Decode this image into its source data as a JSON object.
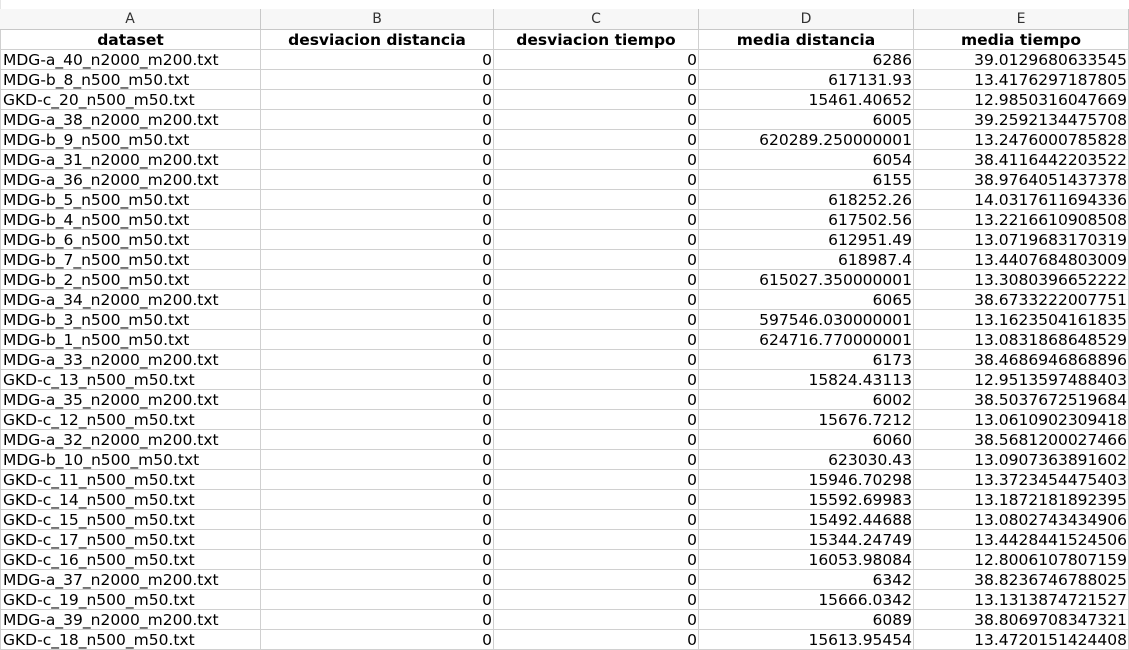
{
  "columns": [
    "A",
    "B",
    "C",
    "D",
    "E"
  ],
  "headers": [
    "dataset",
    "desviacion distancia",
    "desviacion tiempo",
    "media distancia",
    "media tiempo"
  ],
  "rows": [
    [
      "MDG-a_40_n2000_m200.txt",
      "0",
      "0",
      "6286",
      "39.0129680633545"
    ],
    [
      "MDG-b_8_n500_m50.txt",
      "0",
      "0",
      "617131.93",
      "13.4176297187805"
    ],
    [
      "GKD-c_20_n500_m50.txt",
      "0",
      "0",
      "15461.40652",
      "12.9850316047669"
    ],
    [
      "MDG-a_38_n2000_m200.txt",
      "0",
      "0",
      "6005",
      "39.2592134475708"
    ],
    [
      "MDG-b_9_n500_m50.txt",
      "0",
      "0",
      "620289.250000001",
      "13.2476000785828"
    ],
    [
      "MDG-a_31_n2000_m200.txt",
      "0",
      "0",
      "6054",
      "38.4116442203522"
    ],
    [
      "MDG-a_36_n2000_m200.txt",
      "0",
      "0",
      "6155",
      "38.9764051437378"
    ],
    [
      "MDG-b_5_n500_m50.txt",
      "0",
      "0",
      "618252.26",
      "14.0317611694336"
    ],
    [
      "MDG-b_4_n500_m50.txt",
      "0",
      "0",
      "617502.56",
      "13.2216610908508"
    ],
    [
      "MDG-b_6_n500_m50.txt",
      "0",
      "0",
      "612951.49",
      "13.0719683170319"
    ],
    [
      "MDG-b_7_n500_m50.txt",
      "0",
      "0",
      "618987.4",
      "13.4407684803009"
    ],
    [
      "MDG-b_2_n500_m50.txt",
      "0",
      "0",
      "615027.350000001",
      "13.3080396652222"
    ],
    [
      "MDG-a_34_n2000_m200.txt",
      "0",
      "0",
      "6065",
      "38.6733222007751"
    ],
    [
      "MDG-b_3_n500_m50.txt",
      "0",
      "0",
      "597546.030000001",
      "13.1623504161835"
    ],
    [
      "MDG-b_1_n500_m50.txt",
      "0",
      "0",
      "624716.770000001",
      "13.0831868648529"
    ],
    [
      "MDG-a_33_n2000_m200.txt",
      "0",
      "0",
      "6173",
      "38.4686946868896"
    ],
    [
      "GKD-c_13_n500_m50.txt",
      "0",
      "0",
      "15824.43113",
      "12.9513597488403"
    ],
    [
      "MDG-a_35_n2000_m200.txt",
      "0",
      "0",
      "6002",
      "38.5037672519684"
    ],
    [
      "GKD-c_12_n500_m50.txt",
      "0",
      "0",
      "15676.7212",
      "13.0610902309418"
    ],
    [
      "MDG-a_32_n2000_m200.txt",
      "0",
      "0",
      "6060",
      "38.5681200027466"
    ],
    [
      "MDG-b_10_n500_m50.txt",
      "0",
      "0",
      "623030.43",
      "13.0907363891602"
    ],
    [
      "GKD-c_11_n500_m50.txt",
      "0",
      "0",
      "15946.70298",
      "13.3723454475403"
    ],
    [
      "GKD-c_14_n500_m50.txt",
      "0",
      "0",
      "15592.69983",
      "13.1872181892395"
    ],
    [
      "GKD-c_15_n500_m50.txt",
      "0",
      "0",
      "15492.44688",
      "13.0802743434906"
    ],
    [
      "GKD-c_17_n500_m50.txt",
      "0",
      "0",
      "15344.24749",
      "13.4428441524506"
    ],
    [
      "GKD-c_16_n500_m50.txt",
      "0",
      "0",
      "16053.98084",
      "12.8006107807159"
    ],
    [
      "MDG-a_37_n2000_m200.txt",
      "0",
      "0",
      "6342",
      "38.8236746788025"
    ],
    [
      "GKD-c_19_n500_m50.txt",
      "0",
      "0",
      "15666.0342",
      "13.1313874721527"
    ],
    [
      "MDG-a_39_n2000_m200.txt",
      "0",
      "0",
      "6089",
      "38.8069708347321"
    ],
    [
      "GKD-c_18_n500_m50.txt",
      "0",
      "0",
      "15613.95454",
      "13.4720151424408"
    ]
  ]
}
